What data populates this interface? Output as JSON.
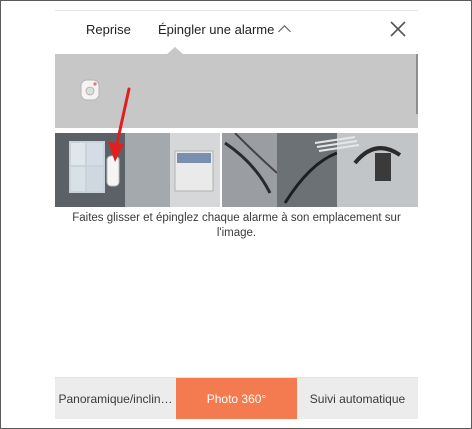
{
  "header": {
    "tab_reprise": "Reprise",
    "tab_pin_alarm": "Épingler une alarme"
  },
  "icons": {
    "chevron": "chevron-up-icon",
    "close": "close-icon",
    "sensor": "alarm-sensor-icon",
    "arrow": "red-arrow-icon"
  },
  "instructions": "Faites glisser et épinglez chaque alarme à son emplacement sur l'image.",
  "modes": {
    "items": [
      "Panoramique/inclin…",
      "Photo 360°",
      "Suivi automatique"
    ],
    "selected": "Photo 360°"
  },
  "colors": {
    "accent": "#f47b4f",
    "tray": "#c7c7c7",
    "arrow": "#e02020"
  }
}
